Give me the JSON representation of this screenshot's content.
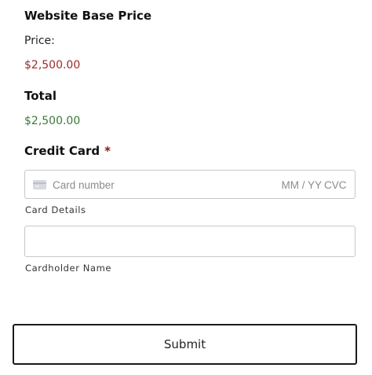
{
  "product": {
    "name": "Website Base Price",
    "price_label": "Price:",
    "price_value": "$2,500.00"
  },
  "total": {
    "label": "Total",
    "value": "$2,500.00"
  },
  "payment": {
    "label": "Credit Card",
    "required_marker": "*",
    "card_icon": "credit-card-icon",
    "card_number_placeholder": "Card number",
    "expiry_placeholder": "MM / YY",
    "cvc_placeholder": "CVC",
    "card_details_label": "Card Details",
    "cardholder_name_value": "",
    "cardholder_name_label": "Cardholder Name"
  },
  "submit_label": "Submit",
  "colors": {
    "price": "#9b2a2a",
    "total": "#3a7a33",
    "required": "#8b1111",
    "field_border": "#c8c8c8",
    "button_border": "#1a1a1a"
  }
}
